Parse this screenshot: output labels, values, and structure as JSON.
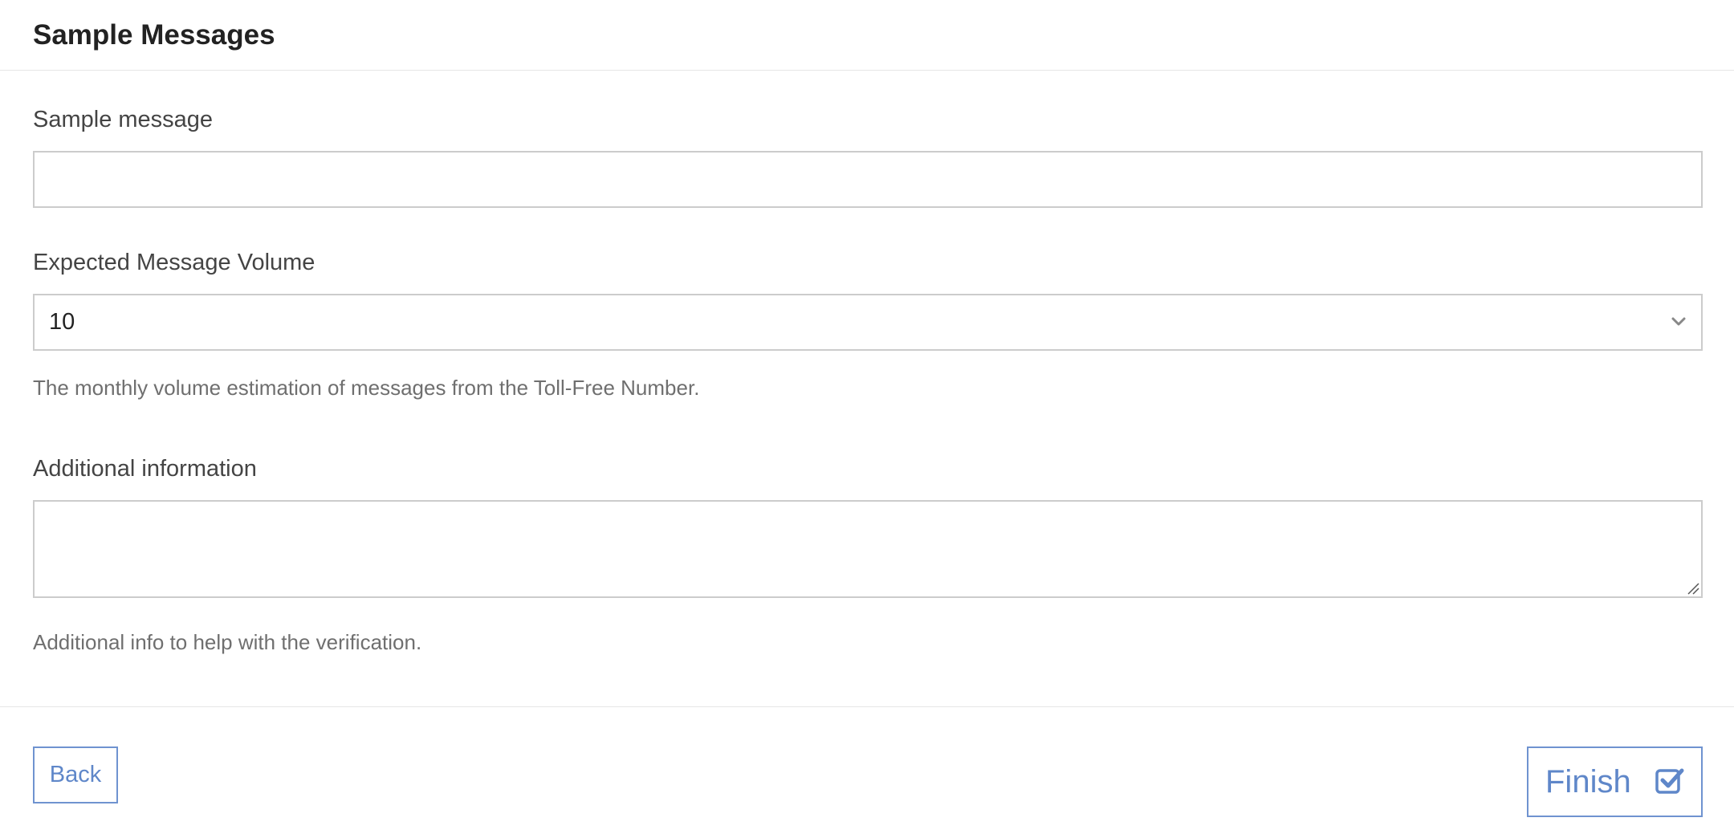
{
  "header": {
    "title": "Sample Messages"
  },
  "sample_message": {
    "label": "Sample message",
    "value": "",
    "placeholder": ""
  },
  "volume": {
    "label": "Expected Message Volume",
    "selected": "10",
    "help": "The monthly volume estimation of messages from the Toll-Free Number."
  },
  "additional": {
    "label": "Additional information",
    "value": "",
    "help": "Additional info to help with the verification."
  },
  "actions": {
    "back_label": "Back",
    "finish_label": "Finish"
  },
  "icons": {
    "select_chevron": "chevron-down-icon",
    "finish": "checkbox-checked-icon"
  },
  "colors": {
    "accent": "#5f87c9",
    "border": "#cccccc",
    "help_text": "#6f6f6f"
  }
}
